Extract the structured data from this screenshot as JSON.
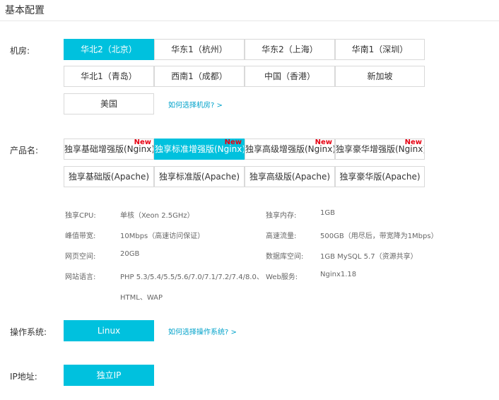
{
  "header": {
    "title": "基本配置"
  },
  "datacenter": {
    "label": "机房:",
    "options": [
      "华北2（北京）",
      "华东1（杭州）",
      "华东2（上海）",
      "华南1（深圳）",
      "华北1（青岛）",
      "西南1（成都）",
      "中国（香港）",
      "新加坡",
      "美国"
    ],
    "selected": "华北2（北京）",
    "help": "如何选择机房? >"
  },
  "product": {
    "label": "产品名:",
    "new_badge": "New",
    "options": [
      "独享基础增强版(Nginx)",
      "独享标准增强版(Nginx)",
      "独享高级增强版(Nginx)",
      "独享豪华增强版(Nginx)",
      "独享基础版(Apache)",
      "独享标准版(Apache)",
      "独享高级版(Apache)",
      "独享豪华版(Apache)"
    ],
    "selected": "独享标准增强版(Nginx)"
  },
  "specs": {
    "cpu": {
      "label": "独享CPU:",
      "value": "单核（Xeon 2.5GHz）"
    },
    "memory": {
      "label": "独享内存:",
      "value": "1GB"
    },
    "bandwidth": {
      "label": "峰值带宽:",
      "value": "10Mbps（高速访问保证）"
    },
    "traffic": {
      "label": "高速流量:",
      "value": "500GB（用尽后，带宽降为1Mbps）"
    },
    "disk": {
      "label": "网页空间:",
      "value": "20GB"
    },
    "database": {
      "label": "数据库空间:",
      "value": "1GB MySQL 5.7（资源共享）"
    },
    "language": {
      "label": "网站语言:",
      "value_line1": "PHP 5.3/5.4/5.5/5.6/7.0/7.1/7.2/7.4/8.0、",
      "value_line2": "HTML、WAP"
    },
    "webserver": {
      "label": "Web服务:",
      "value": "Nginx1.18"
    }
  },
  "os": {
    "label": "操作系统:",
    "selected": "Linux",
    "help": "如何选择操作系统? >"
  },
  "ip": {
    "label": "IP地址:",
    "selected": "独立IP"
  },
  "colors": {
    "accent": "#00c1de",
    "link": "#00a2ca",
    "badge": "#e60012",
    "border": "#d9d9d9"
  }
}
